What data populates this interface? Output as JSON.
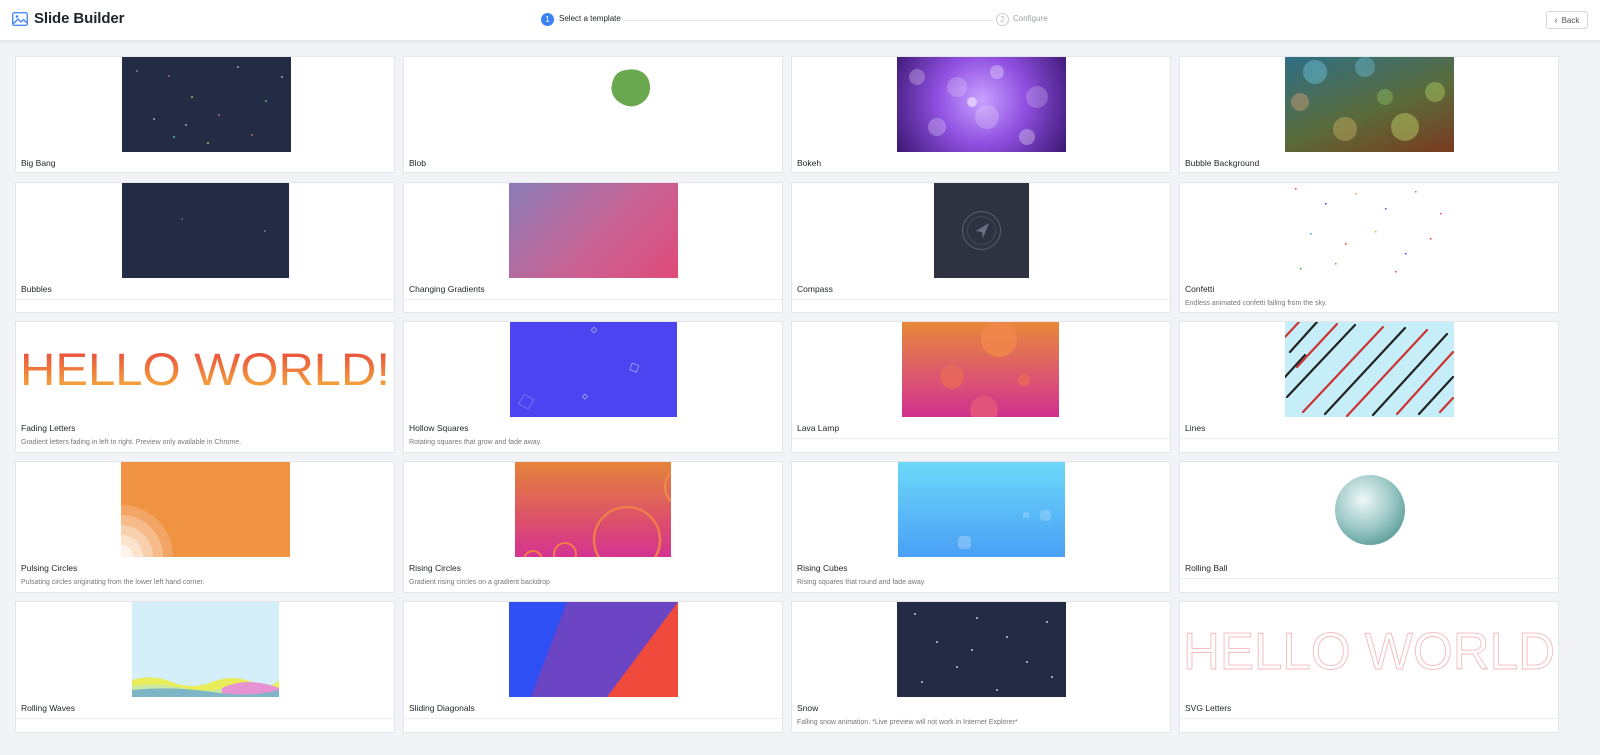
{
  "header": {
    "title": "Slide Builder",
    "steps": [
      {
        "number": "1",
        "label": "Select a template",
        "active": true
      },
      {
        "number": "2",
        "label": "Configure",
        "active": false
      }
    ],
    "back_label": "Back"
  },
  "templates": [
    {
      "name": "Big Bang",
      "description": ""
    },
    {
      "name": "Blob",
      "description": ""
    },
    {
      "name": "Bokeh",
      "description": ""
    },
    {
      "name": "Bubble Background",
      "description": ""
    },
    {
      "name": "Bubbles",
      "description": ""
    },
    {
      "name": "Changing Gradients",
      "description": ""
    },
    {
      "name": "Compass",
      "description": ""
    },
    {
      "name": "Confetti",
      "description": "Endless animated confetti falling from the sky."
    },
    {
      "name": "Fading Letters",
      "description": "Gradient letters fading in left to right. Preview only available in Chrome.",
      "preview_text": "HELLO WORLD!"
    },
    {
      "name": "Hollow Squares",
      "description": "Rotating squares that grow and fade away."
    },
    {
      "name": "Lava Lamp",
      "description": ""
    },
    {
      "name": "Lines",
      "description": ""
    },
    {
      "name": "Pulsing Circles",
      "description": "Pulsating circles originating from the lower left hand corner."
    },
    {
      "name": "Rising Circles",
      "description": "Gradient rising circles on a gradient backdrop"
    },
    {
      "name": "Rising Cubes",
      "description": "Rising squares that round and fade away"
    },
    {
      "name": "Rolling Ball",
      "description": ""
    },
    {
      "name": "Rolling Waves",
      "description": ""
    },
    {
      "name": "Sliding Diagonals",
      "description": ""
    },
    {
      "name": "Snow",
      "description": "Falling snow animation. *Live preview will not work in Internet Explorer*"
    },
    {
      "name": "SVG Letters",
      "description": "",
      "preview_text": "HELLO WORLD"
    }
  ]
}
